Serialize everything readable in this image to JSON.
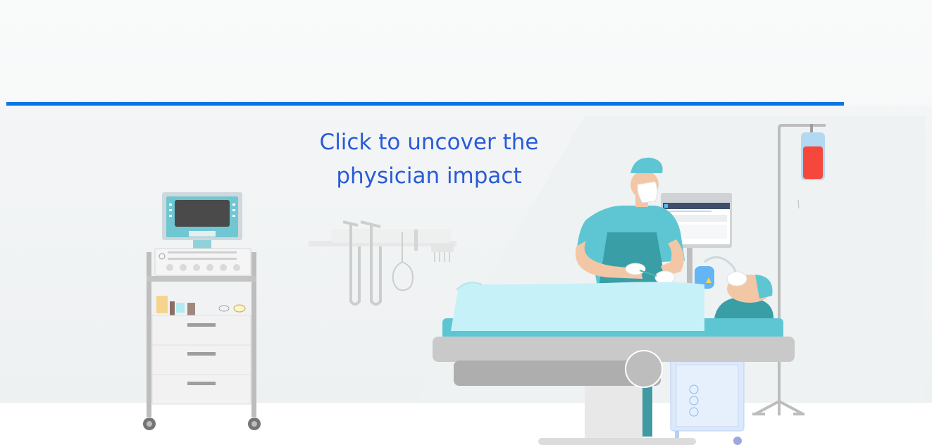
{
  "colors": {
    "accent_bar": "#0b74e5",
    "cta_text": "#2a5bd7",
    "scrub_teal": "#5ec6d3",
    "sheet_blue": "#c7f1f8",
    "bed_gray": "#c9c9c9",
    "iv_red": "#f5473b"
  },
  "cta": {
    "line1": "Click to uncover the",
    "line2": "physician impact"
  },
  "icons": [
    "medical-cart-icon",
    "monitor-icon",
    "stethoscope-icon",
    "physician-icon",
    "patient-icon",
    "operating-table-icon",
    "iv-stand-icon",
    "anesthesia-machine-icon"
  ]
}
